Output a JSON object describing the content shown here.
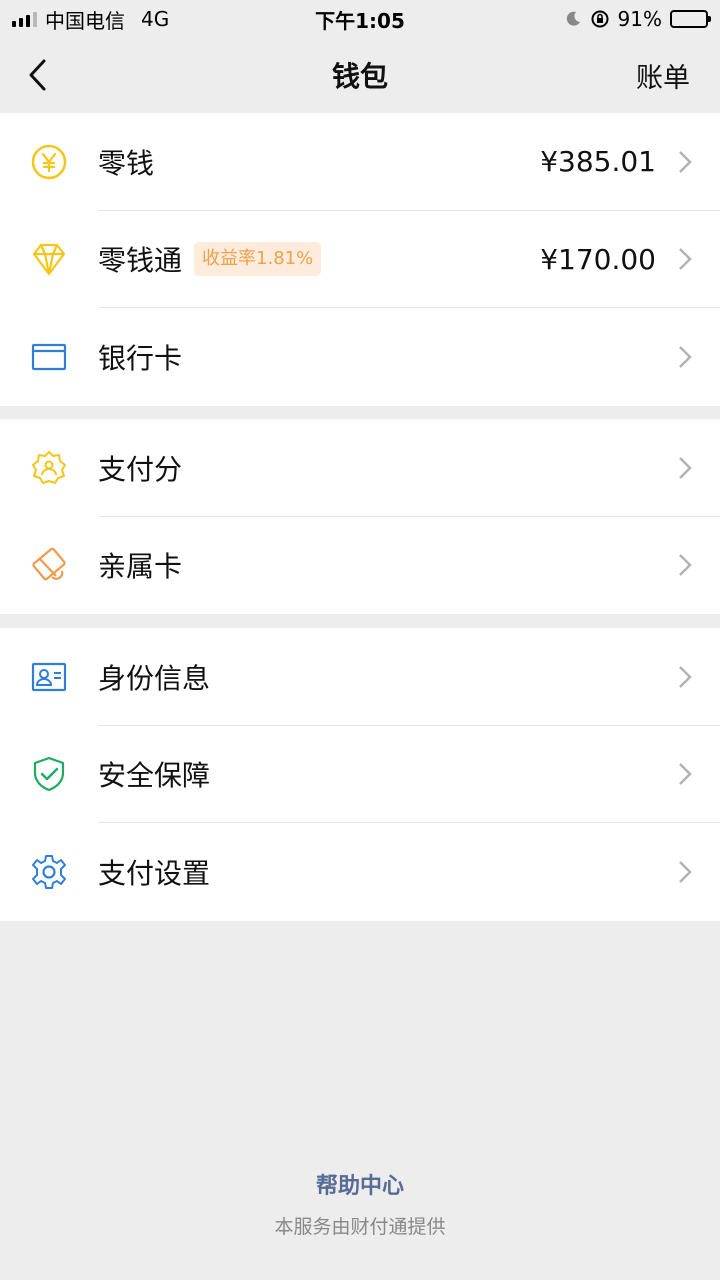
{
  "status_bar": {
    "carrier": "中国电信",
    "network": "4G",
    "time": "下午1:05",
    "battery": "91%",
    "battery_level": 0.91
  },
  "nav": {
    "title": "钱包",
    "right_label": "账单"
  },
  "groups": [
    {
      "items": [
        {
          "label": "零钱",
          "value": "¥385.01",
          "icon": "yuan-coin-icon"
        },
        {
          "label": "零钱通",
          "badge": "收益率1.81%",
          "value": "¥170.00",
          "icon": "diamond-icon"
        },
        {
          "label": "银行卡",
          "icon": "bank-card-icon"
        }
      ]
    },
    {
      "items": [
        {
          "label": "支付分",
          "icon": "pay-score-icon"
        },
        {
          "label": "亲属卡",
          "icon": "family-card-icon"
        }
      ]
    },
    {
      "items": [
        {
          "label": "身份信息",
          "icon": "id-card-icon"
        },
        {
          "label": "安全保障",
          "icon": "shield-check-icon"
        },
        {
          "label": "支付设置",
          "icon": "gear-icon"
        }
      ]
    }
  ],
  "footer": {
    "help": "帮助中心",
    "provider": "本服务由财付通提供"
  },
  "colors": {
    "background": "#ededed",
    "link": "#576b95",
    "badge_bg": "#fdebdc",
    "badge_text": "#f0a04e",
    "yellow_icon": "#f5c518",
    "blue_icon": "#2f7fd8",
    "green_icon": "#1aad62",
    "orange_icon": "#ef9a4a"
  }
}
